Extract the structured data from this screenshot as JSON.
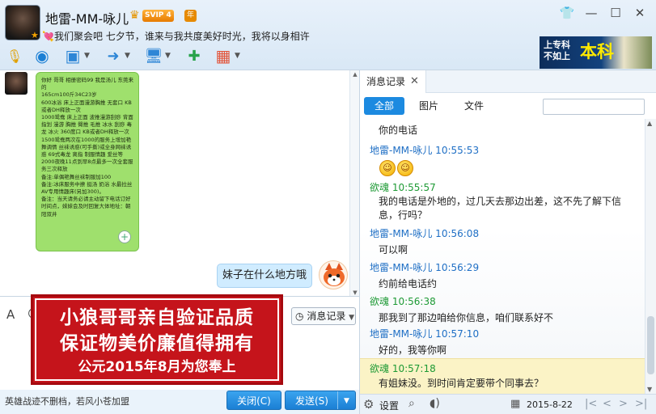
{
  "header": {
    "nickname": "地雷-MM-咏儿",
    "vip_badge": "SVIP 4",
    "year_badge": "年",
    "signature": "💘我们聚会吧 七夕节，谁来与我共度美好时光，我将以身相许"
  },
  "toolbar": {
    "items": [
      {
        "name": "microphone-icon",
        "glyph": "🎙"
      },
      {
        "name": "webcam-icon",
        "glyph": "◉"
      },
      {
        "name": "screen-share-icon",
        "glyph": "▣"
      },
      {
        "name": "send-file-icon",
        "glyph": "➜"
      },
      {
        "name": "remote-desktop-icon",
        "glyph": "🖥"
      },
      {
        "name": "add-app-icon",
        "glyph": "✚"
      },
      {
        "name": "apps-grid-icon",
        "glyph": "▦"
      }
    ]
  },
  "ad": {
    "line1": "上专科",
    "line2": "不如上",
    "big": "本科"
  },
  "chat": {
    "green_bubble_text": "你好 哥哥 相册密码99 我是汤儿 东莞来的\n165cm100斤34C23岁\n600冰浴 床上正面漫游胸推 无套口 KB或者DH释放一次\n1000鸳鸯 床上正面 波推漫游刮痧 背面指划 漫游 胸推 臀推 毛推 冰水 刮痧 毒龙 冰火 360度口 KB或者DH释放一次\n1500鸳鸯两次在1000的服务上增加艳舞调情 丝袜诱惑(可手撕)或全身网袜诱惑 69式毒龙 离指 制服情趣 爱丝等\n2000夜晚11点到早8点最多一次全套服务三次释放\n备注:单偶艳舞丝袜制服加100\n备注:冰床服务中撩 挺汤 奶浴 水最拉丝AV专用情趣床(另加300)。\n备注：当天请务必请主动留下电话订好时间点，妹妹会及时回复大体地址：朝阳双井",
    "my_message": "妹子在什么地方哦"
  },
  "input_tools": {
    "history_button": "消息记录"
  },
  "stamp": {
    "line1": "小狼哥哥亲自验证品质",
    "line2": "保证物美价廉值得拥有",
    "line3": "公元2015年8月为您奉上"
  },
  "bottom": {
    "notice": "英雄战迹不删档，若风小苍加盟",
    "close_label": "关闭(C)",
    "send_label": "发送(S)"
  },
  "history": {
    "tab_label": "消息记录",
    "filters": {
      "all": "全部",
      "images": "图片",
      "files": "文件"
    },
    "messages": [
      {
        "text": "你的电话"
      },
      {
        "sender": "地雷-MM-咏儿 10:55:53",
        "who": "other"
      },
      {
        "emoji": true
      },
      {
        "sender": "欲魂 10:55:57",
        "who": "me"
      },
      {
        "text": "我的电话是外地的，过几天去那边出差，这不先了解下信息，行吗？"
      },
      {
        "sender": "地雷-MM-咏儿 10:56:08",
        "who": "other"
      },
      {
        "text": "可以啊"
      },
      {
        "sender": "地雷-MM-咏儿 10:56:29",
        "who": "other"
      },
      {
        "text": "约前给电话约"
      },
      {
        "sender": "欲魂 10:56:38",
        "who": "me"
      },
      {
        "text": "那我到了那边咱给你信息，咱们联系好不"
      },
      {
        "sender": "地雷-MM-咏儿 10:57:10",
        "who": "other"
      },
      {
        "text": "好的，我等你啊"
      },
      {
        "sender": "欲魂 10:57:18",
        "who": "me"
      },
      {
        "text": "有姐妹没。到时间肯定要带个同事去？"
      }
    ],
    "footer": {
      "settings_label": "设置",
      "date": "2015-8-22"
    }
  }
}
